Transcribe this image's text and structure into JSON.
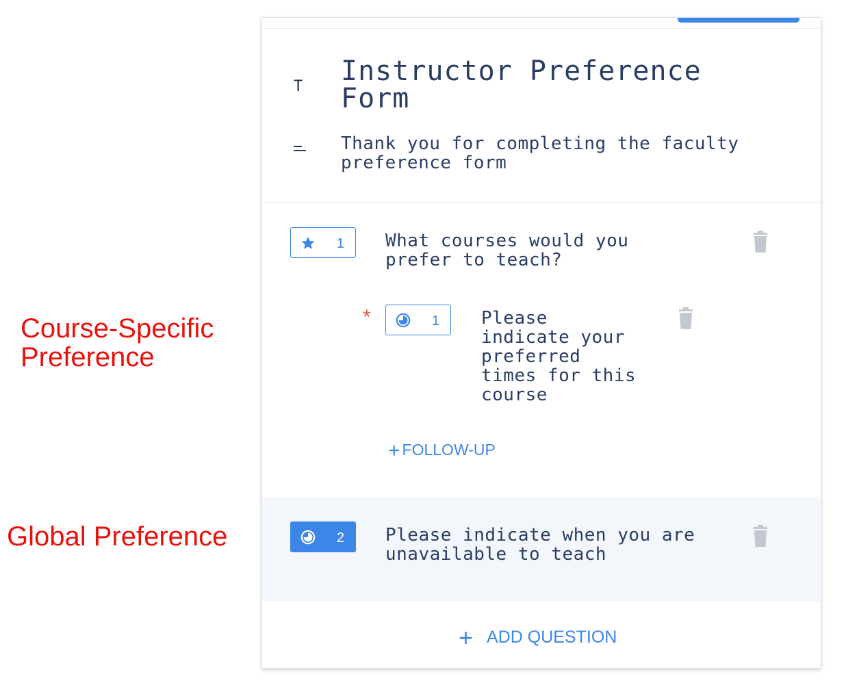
{
  "annotations": {
    "course_specific": "Course-Specific\nPreference",
    "global": "Global Preference"
  },
  "form": {
    "title": "Instructor Preference Form",
    "description": "Thank you for completing the faculty preference form",
    "title_icon": "T",
    "description_icon": "text-lines-icon"
  },
  "questions": [
    {
      "number": "1",
      "icon": "star-icon",
      "text": "What courses would you prefer to teach?",
      "follow_ups": [
        {
          "number": "1",
          "icon": "clock-icon",
          "required_marker": "*",
          "text": "Please indicate your preferred times for this course"
        }
      ],
      "follow_up_label": "FOLLOW-UP"
    },
    {
      "number": "2",
      "icon": "clock-icon",
      "text": "Please indicate when you are unavailable to teach",
      "selected": true
    }
  ],
  "add_question_label": "ADD QUESTION",
  "colors": {
    "accent": "#3b86e6",
    "annotation": "#e8120c",
    "text": "#2a3d63",
    "required": "#e05a48",
    "trash": "#c2c8d0",
    "selected_row": "#f3f7fc"
  }
}
